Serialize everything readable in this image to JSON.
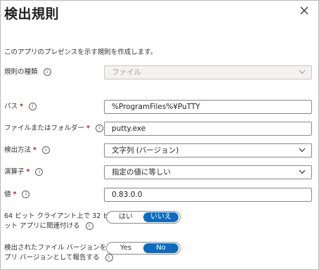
{
  "title": "検出規則",
  "description": "このアプリのプレゼンスを示す規則を作成します。",
  "rule_type": {
    "label": "規則の種類",
    "value": "ファイル"
  },
  "path": {
    "label": "パス",
    "required": "*",
    "value": "%ProgramFiles%¥PuTTY"
  },
  "file_or_folder": {
    "label": "ファイルまたはフォルダー",
    "required": "*",
    "value": "putty.exe"
  },
  "detection_method": {
    "label": "検出方法",
    "required": "*",
    "value": "文字列 (バージョン)"
  },
  "operator": {
    "label": "演算子",
    "required": "*",
    "value": "指定の値に等しい"
  },
  "value_field": {
    "label": "値",
    "required": "*",
    "value": "0.83.0.0"
  },
  "bit64": {
    "label_line1": "64 ビット クライアント上で 32 ビ",
    "label_line2": "ット アプリに関連付ける",
    "yes": "はい",
    "no": "いいえ",
    "selected": "no"
  },
  "report_version": {
    "label_line1": "検出されたファイル バージョンをア",
    "label_line2": "プリ バージョンとして報告する",
    "yes": "Yes",
    "no": "No",
    "selected": "no"
  },
  "icons": {
    "info": "info-icon",
    "close": "close-icon",
    "dropdown": "chevron-down-icon"
  },
  "colors": {
    "accent": "#0f6cbd",
    "required": "#a4262c"
  }
}
